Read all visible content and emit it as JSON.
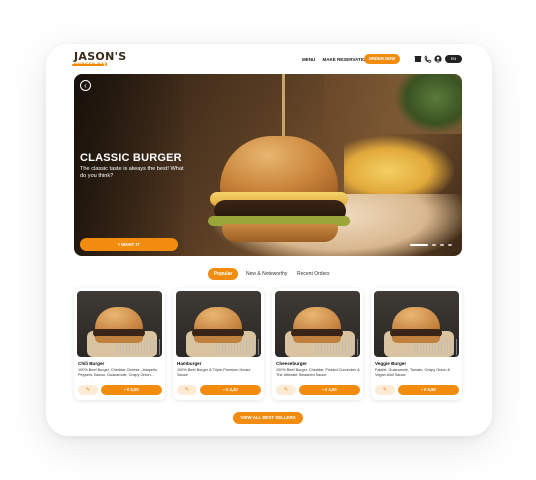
{
  "brand": {
    "name": "JASON'S",
    "tagline": "BURGER BAR"
  },
  "nav": {
    "items": [
      "MENU",
      "MAKE RESERVATION"
    ],
    "order_label": "ORDER NOW",
    "language": "EN"
  },
  "icons": [
    "store-icon",
    "phone-icon",
    "user-icon"
  ],
  "hero": {
    "title": "CLASSIC BURGER",
    "description": "The classic taste is always the best! What do you think?",
    "cta": "I WANT IT",
    "back_icon": "chevron-left-icon"
  },
  "tabs": [
    {
      "label": "Popular",
      "active": true
    },
    {
      "label": "New & Noteworthy",
      "active": false
    },
    {
      "label": "Recent Orders",
      "active": false
    }
  ],
  "products": [
    {
      "name": "Chili Burger",
      "description": "100% Beef Burger, Cheddar Cheese, Jalapeño Peppers, Bacon, Guacamole, Crispy Onion...",
      "price": "€ 5,90"
    },
    {
      "name": "Hamburger",
      "description": "100% Beef Burger & Triple-Premium House Sauce",
      "price": "€ 4,40"
    },
    {
      "name": "Cheeseburger",
      "description": "100% Beef Burger, Cheddar, Pickled Cucumber & The Ultimate Smashed Sauce",
      "price": "€ 4,90"
    },
    {
      "name": "Veggie Burger",
      "description": "Falafel, Guacamole, Tomato, Crispy Onion & Vegan Aioli Sauce",
      "price": "€ 5,90"
    }
  ],
  "view_all": "VIEW ALL BEST SELLERS",
  "colors": {
    "accent": "#f28c0f",
    "dark": "#222222"
  }
}
